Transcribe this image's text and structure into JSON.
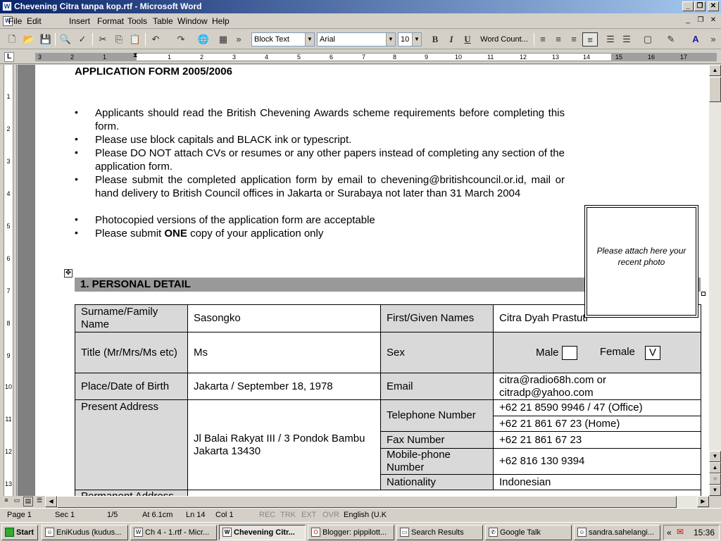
{
  "window": {
    "title": "Chevening Citra tanpa kop.rtf - Microsoft Word",
    "app_icon": "W"
  },
  "menu": [
    "File",
    "Edit",
    "Insert",
    "Format",
    "Tools",
    "Table",
    "Window",
    "Help"
  ],
  "toolbar": {
    "style": "Block Text",
    "font": "Arial",
    "size": "10",
    "bold": "B",
    "italic": "I",
    "underline": "U",
    "word_count": "Word Count..."
  },
  "ruler": {
    "h_numbers": [
      "3",
      "2",
      "1",
      "1",
      "2",
      "3",
      "4",
      "5",
      "6",
      "7",
      "8",
      "9",
      "10",
      "11",
      "12",
      "13",
      "14",
      "15",
      "16",
      "17"
    ],
    "v_numbers": [
      "1",
      "2",
      "3",
      "4",
      "5",
      "6",
      "7",
      "8",
      "9",
      "10",
      "11",
      "12",
      "13"
    ]
  },
  "doc": {
    "heading": "APPLICATION FORM 2005/2006",
    "bullets": [
      "Applicants should read the British Chevening Awards scheme requirements before completing this form.",
      "Please use block capitals and BLACK ink or typescript.",
      "Please DO NOT attach CVs or resumes or any other papers instead of completing any section of the application form.",
      "Please submit the completed application form by email to chevening@britishcouncil.or.id, mail or hand delivery to British Council offices in Jakarta or Surabaya not later than 31 March 2004",
      "Photocopied versions of the application form are acceptable"
    ],
    "last_bullet": {
      "pre": "Please submit ",
      "bold": "ONE",
      "post": " copy of your application only"
    },
    "photo_caption": "Please attach here your recent photo",
    "section1": "1. PERSONAL DETAIL",
    "form": {
      "surname_label": "Surname/Family Name",
      "surname": "Sasongko",
      "first_label": "First/Given Names",
      "first": "Citra Dyah Prastuti",
      "title_label": "Title (Mr/Mrs/Ms etc)",
      "title": "Ms",
      "sex_label": "Sex",
      "male": "Male",
      "female": "Female",
      "female_mark": "V",
      "pob_label": "Place/Date of Birth",
      "pob": "Jakarta / September 18, 1978",
      "email_label": "Email",
      "email": "citra@radio68h.com or citradp@yahoo.com",
      "address_label": "Present Address",
      "address": "Jl Balai Rakyat III / 3 Pondok Bambu Jakarta 13430",
      "tel_label": "Telephone Number",
      "tel_office": "+62 21 8590 9946 / 47 (Office)",
      "tel_home": "+62 21 861 67 23 (Home)",
      "fax_label": "Fax Number",
      "fax": "+62 21 861 67 23",
      "mobile_label": "Mobile-phone Number",
      "mobile": "+62 816 130 9394",
      "nat_label": "Nationality",
      "nat": "Indonesian",
      "perm_label": "Permanent Address"
    }
  },
  "status": {
    "page": "Page 1",
    "sec": "Sec 1",
    "pages": "1/5",
    "at": "At 6.1cm",
    "ln": "Ln 14",
    "col": "Col 1",
    "rec": "REC",
    "trk": "TRK",
    "ext": "EXT",
    "ovr": "OVR",
    "lang": "English (U.K"
  },
  "taskbar": {
    "start": "Start",
    "tasks": [
      "EniKudus (kudus...",
      "Ch 4 - 1.rtf - Micr...",
      "Chevening Citr...",
      "Blogger: pippilott...",
      "Search Results",
      "Google Talk",
      "sandra.sahelangi..."
    ],
    "clock": "15:36"
  }
}
